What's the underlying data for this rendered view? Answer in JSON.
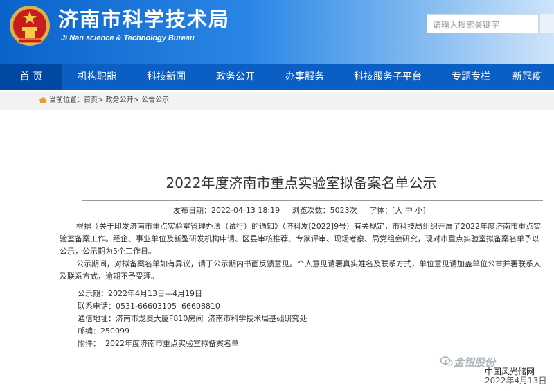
{
  "header": {
    "title": "济南市科学技术局",
    "subtitle": "Ji Nan science & Technology Bureau",
    "search_placeholder": "请输入搜索关键字"
  },
  "nav": {
    "items": [
      {
        "label": "首 页",
        "active": true
      },
      {
        "label": "机构职能"
      },
      {
        "label": "科技新闻"
      },
      {
        "label": "政务公开"
      },
      {
        "label": "办事服务"
      },
      {
        "label": "科技服务子平台"
      },
      {
        "label": "专题专栏"
      },
      {
        "label": "新冠疫"
      }
    ]
  },
  "breadcrumb": {
    "prefix": "当前位置：",
    "home": "首页",
    "sep1": "> ",
    "section": "政务公开",
    "sep2": "> ",
    "current": "公告公示"
  },
  "article": {
    "title": "2022年度济南市重点实验室拟备案名单公示",
    "meta": "发布日期：2022-04-13 18:19     浏览次数：5023次     字体：[大 中 小]",
    "para1": "根据《关于印发济南市重点实验室管理办法（试行）的通知》（济科发[2022]9号）有关规定，市科技局组织开展了2022年度济南市重点实验室备案工作。经企、事业单位及新型研发机构申请、区县审核推荐、专家评审、现场考察、局党组会研究，现对市重点实验室拟备案名单予以公示，公示期为5个工作日。",
    "para2": "公示期间，对拟备案名单如有异议，请于公示期内书面反馈意见。个人意见请署真实姓名及联系方式，单位意见请加盖单位公章并署联系人及联系方式，逾期不予受理。",
    "info": [
      "公示期：2022年4月13日—4月19日",
      "联系电话：0531-66603105  66608810",
      "通信地址：济南市龙奥大厦F810房间  济南市科学技术局基础研究处",
      "邮编：250099",
      "附件：  2022年度济南市重点实验室拟备案名单"
    ]
  },
  "overlay": {
    "watermark": "金银股份",
    "site": "中国风光储网",
    "date": "2022年4月13日"
  }
}
